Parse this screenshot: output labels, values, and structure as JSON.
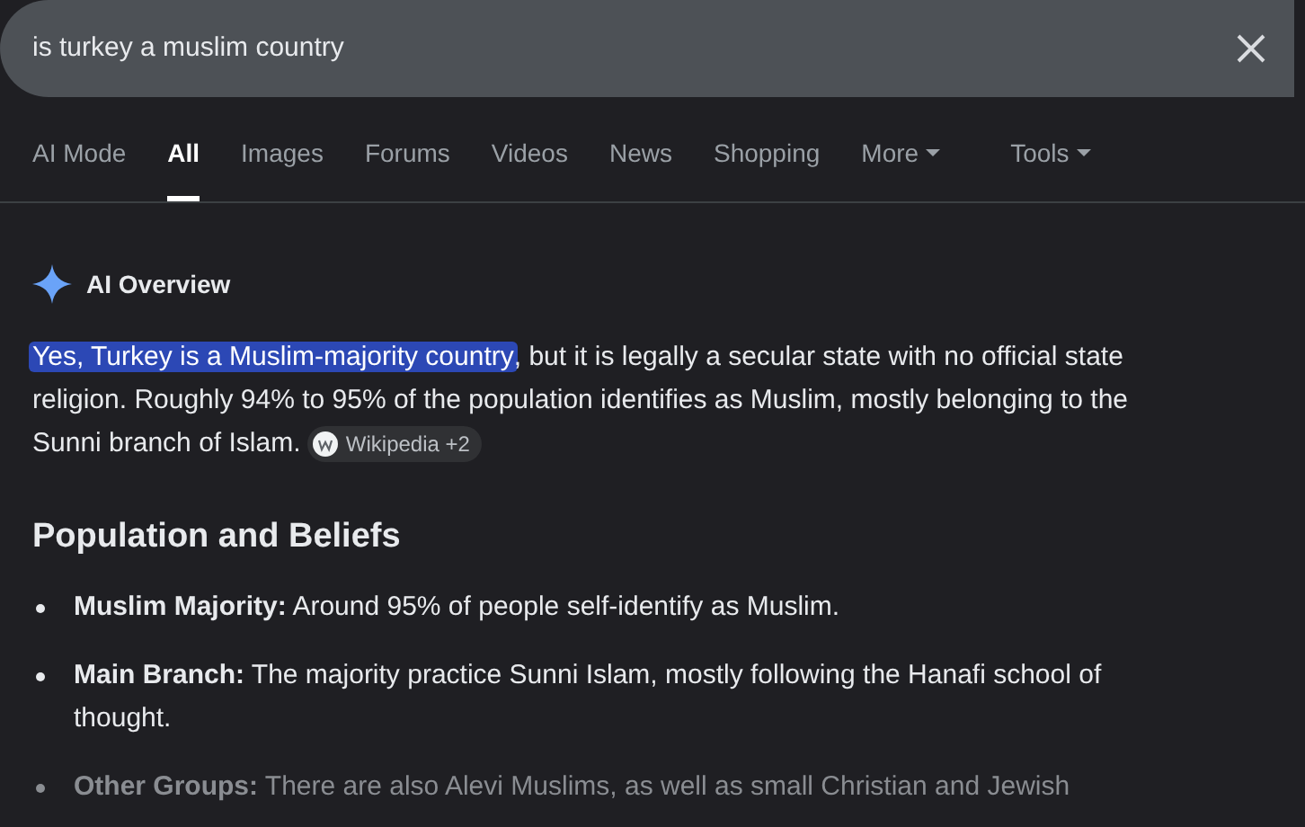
{
  "search": {
    "value": "is turkey a muslim country"
  },
  "tabs": [
    {
      "label": "AI Mode",
      "selected": false,
      "dropdown": false
    },
    {
      "label": "All",
      "selected": true,
      "dropdown": false
    },
    {
      "label": "Images",
      "selected": false,
      "dropdown": false
    },
    {
      "label": "Forums",
      "selected": false,
      "dropdown": false
    },
    {
      "label": "Videos",
      "selected": false,
      "dropdown": false
    },
    {
      "label": "News",
      "selected": false,
      "dropdown": false
    },
    {
      "label": "Shopping",
      "selected": false,
      "dropdown": false
    },
    {
      "label": "More",
      "selected": false,
      "dropdown": true
    },
    {
      "label": "Tools",
      "selected": false,
      "dropdown": true
    }
  ],
  "overview": {
    "title": "AI Overview",
    "summary": [
      {
        "text": "Yes, Turkey is a Muslim-majority country",
        "highlighted": true
      },
      {
        "text": ", but it is legally a secular state with no official state religion. Roughly 94% to 95% of the population identifies as Muslim, mostly belonging to the Sunni branch of Islam.",
        "highlighted": false
      }
    ],
    "summary_source": "Wikipedia +2",
    "heading": "Population and Beliefs",
    "bullets": [
      {
        "text": "**Muslim Majority:** Around 95% of people self-identify as Muslim.",
        "faded": false
      },
      {
        "text": "**Main Branch:** The majority practice Sunni Islam, mostly following the Hanafi school of thought.",
        "faded": false
      },
      {
        "text": "**Other Groups:** There are also Alevi Muslims, as well as small Christian and Jewish",
        "faded": true
      }
    ]
  }
}
